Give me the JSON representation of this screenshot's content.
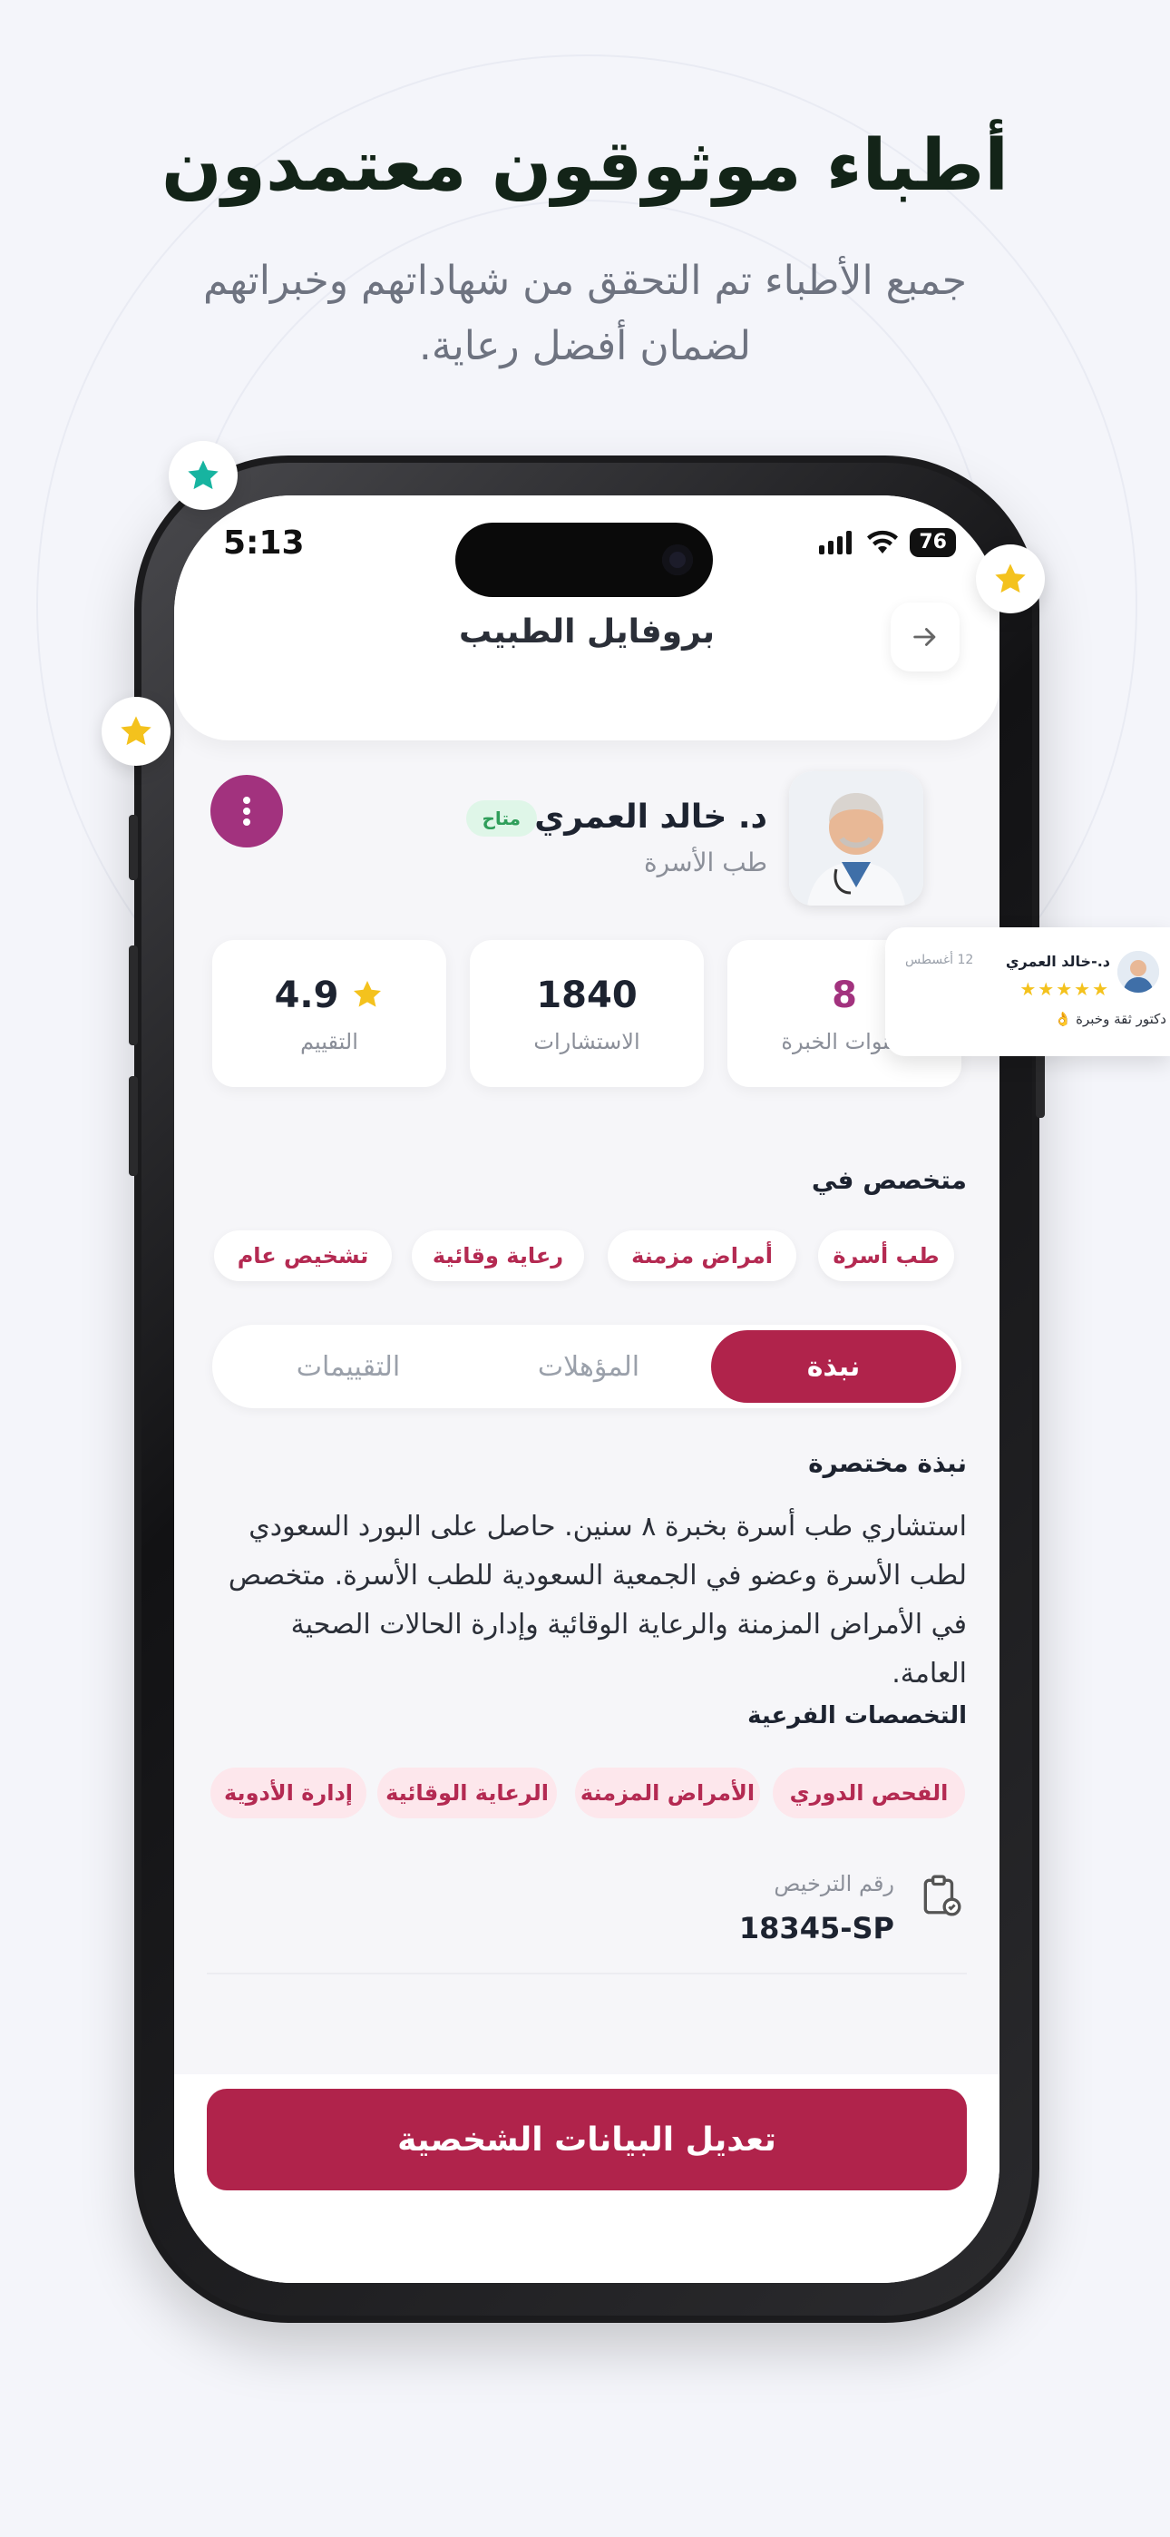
{
  "marketing": {
    "headline": "أطباء موثوقون معتمدون",
    "subline": "جمبع الأطباء تم التحقق من شهاداتهم وخبراتهم لضمان أفضل رعاية."
  },
  "status_bar": {
    "time": "5:13",
    "battery": "76"
  },
  "header": {
    "title": "بروفايل الطبيب"
  },
  "doctor": {
    "name": "د. خالد العمري",
    "badge": "متاح",
    "specialty": "طب الأسرة"
  },
  "stats": [
    {
      "value": "8",
      "label": "سنوات الخبرة"
    },
    {
      "value": "1840",
      "label": "الاستشارات"
    },
    {
      "value": "4.9",
      "label": "التقييم"
    }
  ],
  "specialized": {
    "title": "متخصص في",
    "chips": [
      "طب أسرة",
      "أمراض مزمنة",
      "رعاية وقائية",
      "تشخيص عام"
    ]
  },
  "tabs": [
    "نبذة",
    "المؤهلات",
    "التقييمات"
  ],
  "bio": {
    "title": "نبذة مختصرة",
    "text": "استشاري طب أسرة بخبرة ٨ سنين. حاصل على البورد السعودي لطب الأسرة وعضو في الجمعية السعودية للطب الأسرة. متخصص في الأمراض المزمنة والرعاية الوقائية وإدارة الحالات الصحية العامة."
  },
  "subspecialties": {
    "title": "التخصصات الفرعية",
    "chips": [
      "الفحص الدوري",
      "الأمراض المزمنة",
      "الرعاية الوقائية",
      "إدارة الأدوية"
    ]
  },
  "license": {
    "label": "رقم الترخيص",
    "value": "18345-SP"
  },
  "cta": {
    "label": "تعديل البيانات الشخصية"
  },
  "review_card": {
    "name": "د.-خالد العمري",
    "date": "12 أغسطس",
    "stars": "★★★★★",
    "text": "دكتور ثقة وخبرة 👌"
  },
  "colors": {
    "primary": "#b0234b",
    "accent": "#a2327e",
    "star": "#f4c21d",
    "teal_star": "#17b4a0"
  }
}
